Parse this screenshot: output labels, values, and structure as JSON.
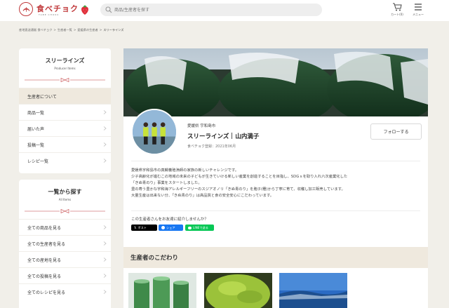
{
  "header": {
    "logo_text": "食べチョク",
    "logo_sub": "TABE CHOKU",
    "search_placeholder": "商品/生産者を探す",
    "cart_label": "カート(0)",
    "menu_label": "メニュー"
  },
  "breadcrumb": [
    "産地直送通販 食べチョク",
    "生産者一覧",
    "愛媛県の生産者",
    "スリーラインズ"
  ],
  "sidebar": {
    "producer": {
      "title": "スリーラインズ",
      "subtitle": "Producer Items",
      "items": [
        "生産者について",
        "商品一覧",
        "届いた声",
        "投稿一覧",
        "レシピ一覧"
      ]
    },
    "all": {
      "title": "一覧から探す",
      "subtitle": "All Items",
      "items": [
        "全ての商品を見る",
        "全ての生産者を見る",
        "全ての産地を見る",
        "全ての投稿を見る",
        "全てのレシピを見る"
      ]
    }
  },
  "profile": {
    "prefecture": "愛媛県 宇和島市",
    "name": "スリーラインズ",
    "person": "山内満子",
    "registered": "食べチョク登録：2021年06月",
    "follow_label": "フォローする",
    "description": [
      "愛媛県宇和島市の真鯛養殖漁師の家族の新しいチャレンジです。",
      "少子高齢化が進むこの地域の未来の子どもが生きていける新しい産業を創造することを目指し、SDGｓを取り入れ六次産業化した",
      "「きぬ青のり」事業をスタートしました。",
      "豊の寿う豊かな宇和海アレルギーフリーのスジアオノリ「きぬ青のり」を胞子(種)から丁寧に育て、収穫し加工販売しています。",
      "大量生産は出来ない分、「きぬ青のり」は高品質と食の安全安心にこだわっています。"
    ],
    "share_question": "この生産者さんをお友達に紹介しませんか？",
    "share_x": "ポスト",
    "share_fb": "シェア",
    "share_line": "LINEで送る"
  },
  "section_title": "生産者のこだわり",
  "colors": {
    "brand_red": "#c0393b",
    "page_bg": "#f1efe9",
    "section_bg": "#efe9de",
    "x_black": "#000000",
    "facebook_blue": "#1877f2",
    "line_green": "#06c755"
  }
}
